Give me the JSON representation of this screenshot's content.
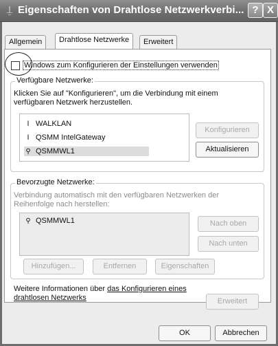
{
  "window": {
    "title": "Eigenschaften von Drahtlose Netzwerkverbi...",
    "icon": "network-connection-icon",
    "help_glyph": "?",
    "close_glyph": "X"
  },
  "tabs": [
    {
      "label": "Allgemein",
      "active": false
    },
    {
      "label": "Drahtlose Netzwerke",
      "active": true
    },
    {
      "label": "Erweitert",
      "active": false
    }
  ],
  "windows_config_checkbox": {
    "label": "Windows zum Konfigurieren der Einstellungen verwenden",
    "checked": false
  },
  "available_networks": {
    "legend": "Verfügbare Netzwerke:",
    "description": "Klicken Sie auf \"Konfigurieren\", um die Verbindung mit einem verfügbaren Netzwerk herzustellen.",
    "items": [
      {
        "name": "WALKLAN",
        "icon": "antenna-icon",
        "selected": false
      },
      {
        "name": "QSMM IntelGateway",
        "icon": "antenna-icon",
        "selected": false
      },
      {
        "name": "QSMMWL1",
        "icon": "wireless-network-icon",
        "selected": true
      }
    ],
    "configure_button": "Konfigurieren",
    "refresh_button": "Aktualisieren"
  },
  "preferred_networks": {
    "legend": "Bevorzugte Netzwerke:",
    "description": "Verbindung automatisch mit den verfügbaren Netzwerken der Reihenfolge nach herstellen:",
    "items": [
      {
        "name": "QSMMWL1",
        "icon": "wireless-network-icon"
      }
    ],
    "move_up_button": "Nach oben",
    "move_down_button": "Nach unten",
    "add_button": "Hinzufügen...",
    "remove_button": "Entfernen",
    "properties_button": "Eigenschaften"
  },
  "footer": {
    "info_prefix": "Weitere Informationen über",
    "info_link": "das Konfigurieren eines drahtlosen Netzwerks",
    "advanced_button": "Erweitert"
  },
  "dialog_buttons": {
    "ok": "OK",
    "cancel": "Abbrechen"
  }
}
